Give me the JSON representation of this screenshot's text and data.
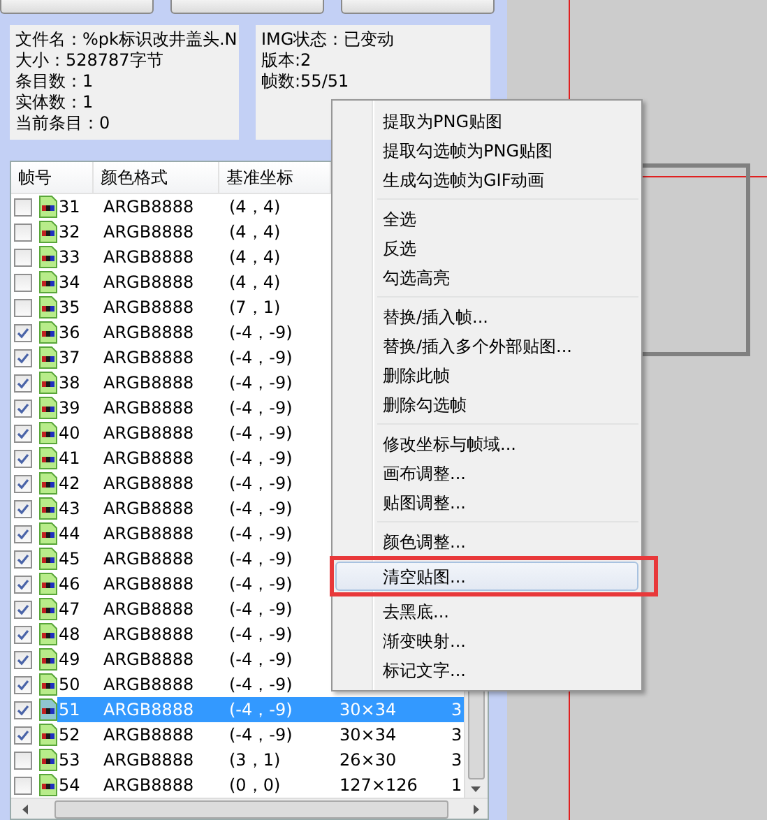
{
  "file_info": [
    "文件名：%pk标识改井盖头.N",
    "大小：528787字节",
    "条目数：1",
    "实体数：1",
    "当前条目：0"
  ],
  "img_info": [
    "IMG状态：已变动",
    "版本:2",
    "帧数:55/51"
  ],
  "table": {
    "columns": [
      "帧号",
      "颜色格式",
      "基准坐标"
    ],
    "rows": [
      {
        "checked": false,
        "selected": false,
        "frame": "31",
        "format": "ARGB8888",
        "coord": "(4，4)"
      },
      {
        "checked": false,
        "selected": false,
        "frame": "32",
        "format": "ARGB8888",
        "coord": "(4，4)"
      },
      {
        "checked": false,
        "selected": false,
        "frame": "33",
        "format": "ARGB8888",
        "coord": "(4，4)"
      },
      {
        "checked": false,
        "selected": false,
        "frame": "34",
        "format": "ARGB8888",
        "coord": "(4，4)"
      },
      {
        "checked": false,
        "selected": false,
        "frame": "35",
        "format": "ARGB8888",
        "coord": "(7，1)"
      },
      {
        "checked": true,
        "selected": false,
        "frame": "36",
        "format": "ARGB8888",
        "coord": "(-4，-9)"
      },
      {
        "checked": true,
        "selected": false,
        "frame": "37",
        "format": "ARGB8888",
        "coord": "(-4，-9)"
      },
      {
        "checked": true,
        "selected": false,
        "frame": "38",
        "format": "ARGB8888",
        "coord": "(-4，-9)"
      },
      {
        "checked": true,
        "selected": false,
        "frame": "39",
        "format": "ARGB8888",
        "coord": "(-4，-9)"
      },
      {
        "checked": true,
        "selected": false,
        "frame": "40",
        "format": "ARGB8888",
        "coord": "(-4，-9)"
      },
      {
        "checked": true,
        "selected": false,
        "frame": "41",
        "format": "ARGB8888",
        "coord": "(-4，-9)"
      },
      {
        "checked": true,
        "selected": false,
        "frame": "42",
        "format": "ARGB8888",
        "coord": "(-4，-9)"
      },
      {
        "checked": true,
        "selected": false,
        "frame": "43",
        "format": "ARGB8888",
        "coord": "(-4，-9)"
      },
      {
        "checked": true,
        "selected": false,
        "frame": "44",
        "format": "ARGB8888",
        "coord": "(-4，-9)"
      },
      {
        "checked": true,
        "selected": false,
        "frame": "45",
        "format": "ARGB8888",
        "coord": "(-4，-9)"
      },
      {
        "checked": true,
        "selected": false,
        "frame": "46",
        "format": "ARGB8888",
        "coord": "(-4，-9)"
      },
      {
        "checked": true,
        "selected": false,
        "frame": "47",
        "format": "ARGB8888",
        "coord": "(-4，-9)"
      },
      {
        "checked": true,
        "selected": false,
        "frame": "48",
        "format": "ARGB8888",
        "coord": "(-4，-9)"
      },
      {
        "checked": true,
        "selected": false,
        "frame": "49",
        "format": "ARGB8888",
        "coord": "(-4，-9)"
      },
      {
        "checked": true,
        "selected": false,
        "frame": "50",
        "format": "ARGB8888",
        "coord": "(-4，-9)"
      },
      {
        "checked": true,
        "selected": true,
        "frame": "51",
        "format": "ARGB8888",
        "coord": "(-4，-9)",
        "column_4": "30×34",
        "column_5": "3"
      },
      {
        "checked": true,
        "selected": false,
        "frame": "52",
        "format": "ARGB8888",
        "coord": "(-4，-9)",
        "column_4": "30×34",
        "column_5": "3"
      },
      {
        "checked": false,
        "selected": false,
        "frame": "53",
        "format": "ARGB8888",
        "coord": "(3，1)",
        "column_4": "26×30",
        "column_5": "3"
      },
      {
        "checked": false,
        "selected": false,
        "frame": "54",
        "format": "ARGB8888",
        "coord": "(0，0)",
        "column_4": "127×126",
        "column_5": "1"
      }
    ]
  },
  "context_menu": [
    [
      {
        "label": "提取为PNG贴图",
        "selected": false
      },
      {
        "label": "提取勾选帧为PNG贴图",
        "selected": false
      },
      {
        "label": "生成勾选帧为GIF动画",
        "selected": false
      }
    ],
    [
      {
        "label": "全选",
        "selected": false
      },
      {
        "label": "反选",
        "selected": false
      },
      {
        "label": "勾选高亮",
        "selected": false
      }
    ],
    [
      {
        "label": "替换/插入帧...",
        "selected": false
      },
      {
        "label": "替换/插入多个外部贴图...",
        "selected": false
      },
      {
        "label": "删除此帧",
        "selected": false
      },
      {
        "label": "删除勾选帧",
        "selected": false
      }
    ],
    [
      {
        "label": "修改坐标与帧域...",
        "selected": false
      },
      {
        "label": "画布调整...",
        "selected": false
      },
      {
        "label": "贴图调整...",
        "selected": false
      }
    ],
    [
      {
        "label": "颜色调整...",
        "selected": false
      },
      {
        "label": "清空贴图...",
        "selected": true
      },
      {
        "label": "去黑底...",
        "selected": false
      },
      {
        "label": "渐变映射...",
        "selected": false
      },
      {
        "label": "标记文字...",
        "selected": false
      }
    ]
  ]
}
